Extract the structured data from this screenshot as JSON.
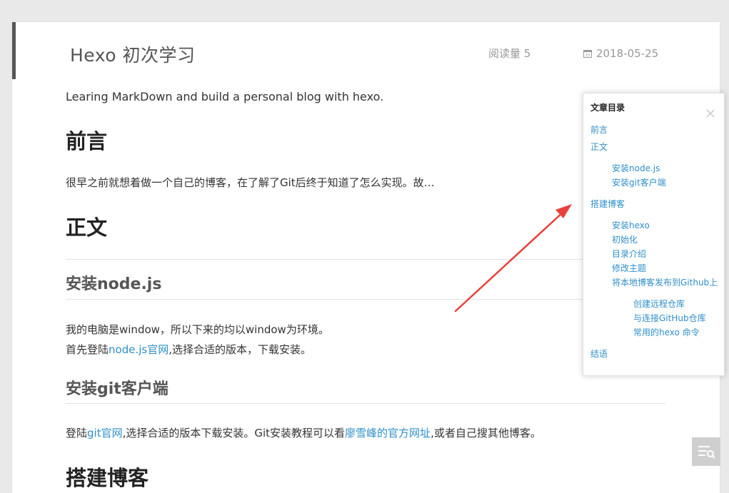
{
  "post": {
    "title": "Hexo 初次学习",
    "reads": "阅读量 5",
    "date": "2018-05-25",
    "intro": "Learing MarkDown and build a personal blog with hexo."
  },
  "sections": {
    "preface_heading": "前言",
    "preface_text": "很早之前就想着做一个自己的博客，在了解了Git后终于知道了怎么实现。故…",
    "body_heading": "正文",
    "node_heading": "安装node.js",
    "node_p1": "我的电脑是window，所以下来的均以window为环境。",
    "node_p2_before": "首先登陆",
    "node_p2_link": "node.js官网",
    "node_p2_after": ",选择合适的版本，下载安装。",
    "git_heading": "安装git客户端",
    "git_p_before": "登陆",
    "git_p_link1": "git官网",
    "git_p_mid": ",选择合适的版本下载安装。Git安装教程可以看",
    "git_p_link2": "廖雪峰的官方网址",
    "git_p_after": ",或者自己搜其他博客。",
    "build_heading": "搭建博客"
  },
  "toc": {
    "title": "文章目录",
    "items": [
      {
        "label": "前言"
      },
      {
        "label": "正文"
      },
      {
        "label": "安装node.js"
      },
      {
        "label": "安装git客户端"
      },
      {
        "label": "搭建博客"
      },
      {
        "label": "安装hexo"
      },
      {
        "label": "初始化"
      },
      {
        "label": "目录介绍"
      },
      {
        "label": "修改主题"
      },
      {
        "label": "将本地博客发布到Github上"
      },
      {
        "label": "创建远程仓库"
      },
      {
        "label": "与连接GitHub仓库"
      },
      {
        "label": "常用的hexo 命令"
      },
      {
        "label": "结语"
      }
    ]
  },
  "icons": {
    "calendar": "calendar-icon",
    "close": "close-icon",
    "toc_toggle": "menu-list-icon"
  },
  "colors": {
    "link": "#2f8fc9",
    "arrow": "#e8413c",
    "accent_bar": "#555555"
  }
}
